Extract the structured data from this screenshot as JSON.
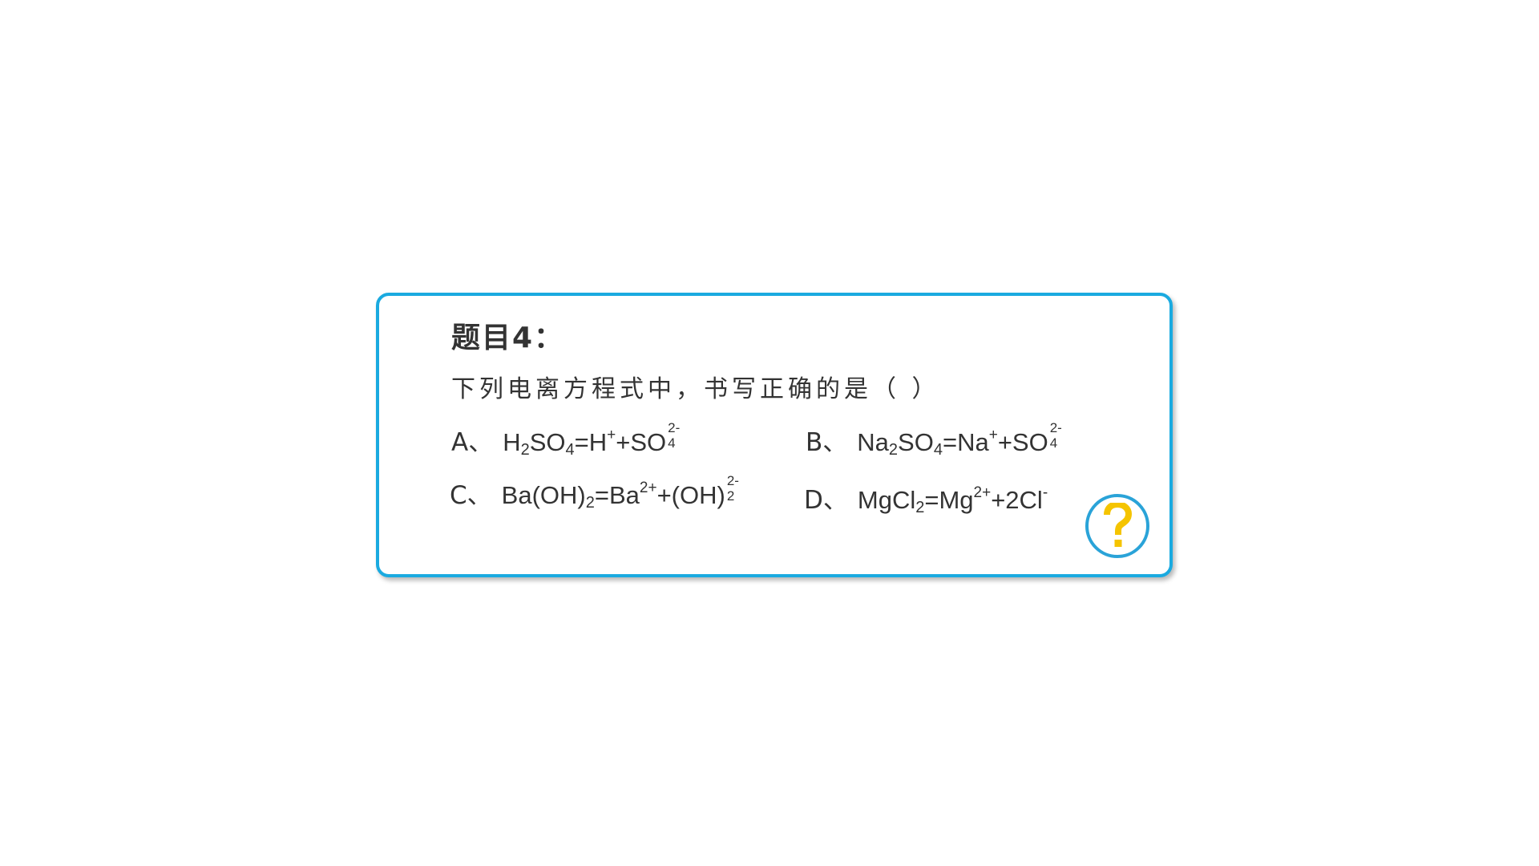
{
  "question": {
    "title": "题目4：",
    "prompt": "下列电离方程式中，书写正确的是（   ）"
  },
  "options": {
    "a": {
      "letter": "A",
      "sep": "、",
      "parts": [
        "H",
        "2",
        "SO",
        "4",
        "=H",
        "+",
        "+SO",
        "2-",
        "4"
      ]
    },
    "b": {
      "letter": "B",
      "sep": "、",
      "parts": [
        "Na",
        "2",
        "SO",
        "4",
        "=Na",
        "+",
        "+SO",
        "2-",
        "4"
      ]
    },
    "c": {
      "letter": "C",
      "sep": "、",
      "parts": [
        "Ba(OH)",
        "2",
        "=Ba",
        "2+",
        "+(OH)",
        "2-",
        "2"
      ]
    },
    "d": {
      "letter": "D",
      "sep": "、",
      "parts": [
        "MgCl",
        "2",
        "=Mg",
        "2+",
        "+2Cl",
        "-"
      ]
    }
  },
  "icons": {
    "help": "question-mark-icon"
  },
  "colors": {
    "border": "#1AAAE0",
    "icon_ring": "#2AA3D8",
    "icon_glyph": "#F5C400",
    "text": "#333333"
  }
}
